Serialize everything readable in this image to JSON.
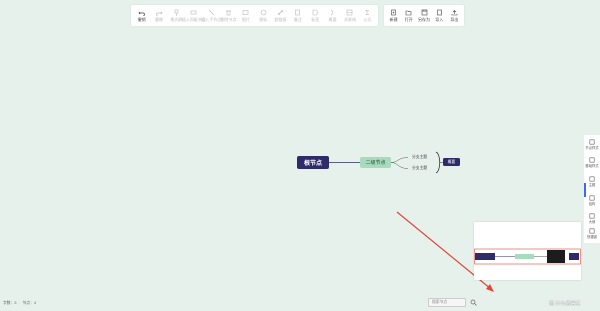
{
  "toolbar": {
    "items": [
      {
        "label": "撤销",
        "icon": "undo-icon",
        "enabled": true
      },
      {
        "label": "重做",
        "icon": "redo-icon",
        "enabled": false
      },
      {
        "label": "格式刷",
        "icon": "format-brush-icon",
        "enabled": false
      },
      {
        "label": "插入同级节点",
        "icon": "sibling-node-icon",
        "enabled": false
      },
      {
        "label": "插入子节点",
        "icon": "child-node-icon",
        "enabled": false
      },
      {
        "label": "删除节点",
        "icon": "delete-node-icon",
        "enabled": false
      },
      {
        "label": "图片",
        "icon": "image-icon",
        "enabled": false
      },
      {
        "label": "图标",
        "icon": "emoji-icon",
        "enabled": false
      },
      {
        "label": "超链接",
        "icon": "link-icon",
        "enabled": false
      },
      {
        "label": "备注",
        "icon": "note-icon",
        "enabled": false
      },
      {
        "label": "标签",
        "icon": "tag-icon",
        "enabled": false
      },
      {
        "label": "概要",
        "icon": "summary-icon",
        "enabled": false
      },
      {
        "label": "关联线",
        "icon": "relation-line-icon",
        "enabled": false
      },
      {
        "label": "公式",
        "icon": "formula-icon",
        "enabled": false
      }
    ],
    "file_items": [
      {
        "label": "新建",
        "icon": "new-file-icon",
        "enabled": true
      },
      {
        "label": "打开",
        "icon": "open-folder-icon",
        "enabled": true
      },
      {
        "label": "另存为",
        "icon": "save-as-icon",
        "enabled": true
      },
      {
        "label": "导入",
        "icon": "import-icon",
        "enabled": true
      },
      {
        "label": "导出",
        "icon": "export-icon",
        "enabled": true
      }
    ]
  },
  "mindmap": {
    "root": "根节点",
    "second": "二级节点",
    "branches": [
      "分支主题",
      "分支主题"
    ],
    "summary": "概要"
  },
  "sidebar": {
    "items": [
      {
        "label": "节点样式",
        "icon": "node-style-icon"
      },
      {
        "label": "基础样式",
        "icon": "base-style-icon"
      },
      {
        "label": "主题",
        "icon": "theme-icon"
      },
      {
        "label": "结构",
        "icon": "structure-icon"
      },
      {
        "label": "大纲",
        "icon": "outline-icon"
      },
      {
        "label": "快捷键",
        "icon": "keyboard-icon"
      }
    ]
  },
  "status": {
    "words": "字数：5",
    "nodes": "节点：4",
    "zoom_placeholder": "搜索节点"
  },
  "watermark": "值 什么值得买",
  "colors": {
    "background": "#e7f1ec",
    "root_fill": "#2f2b6b",
    "second_fill": "#a6dbbe",
    "accent": "#3a6cf0",
    "arrow": "#e0463a"
  }
}
